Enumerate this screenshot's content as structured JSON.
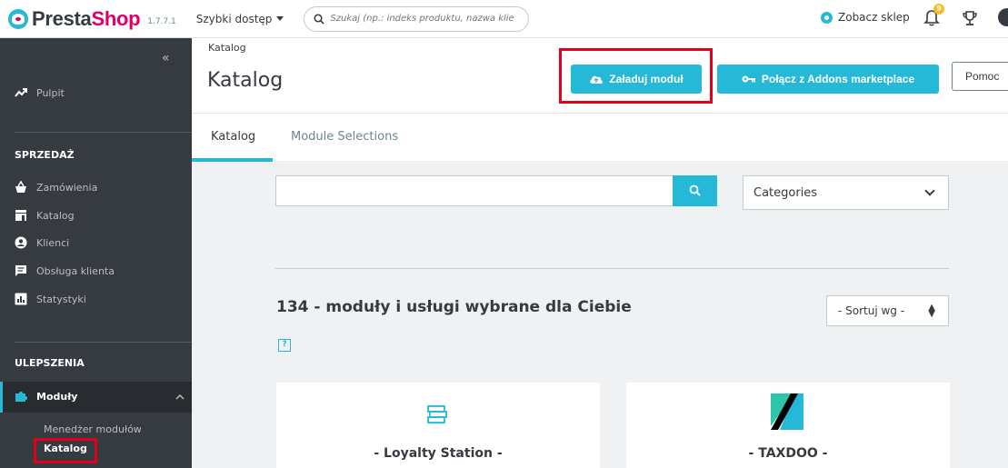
{
  "topbar": {
    "logo_part1": "Presta",
    "logo_part2": "Shop",
    "version": "1.7.7.1",
    "quick_access": "Szybki dostęp",
    "search_placeholder": "Szukaj (np.: indeks produktu, nazwa klie",
    "view_shop": "Zobacz sklep",
    "notifications_count": "9"
  },
  "sidebar": {
    "dashboard": "Pulpit",
    "sales_title": "SPRZEDAŻ",
    "sales_items": [
      "Zamówienia",
      "Katalog",
      "Klienci",
      "Obsługa klienta",
      "Statystyki"
    ],
    "improve_title": "ULEPSZENIA",
    "modules": "Moduły",
    "sub_items": [
      "Menedżer modułów",
      "Katalog"
    ]
  },
  "header": {
    "breadcrumb": "Katalog",
    "title": "Katalog",
    "upload_button": "Załaduj moduł",
    "addons_button": "Połącz z Addons marketplace",
    "help_button": "Pomoc"
  },
  "tabs": [
    "Katalog",
    "Module Selections"
  ],
  "main": {
    "search_value": "",
    "category_select": "Categories",
    "count_text": "134 - moduły i usługi wybrane dla Ciebie",
    "sort_select": "- Sortuj wg -",
    "help_icon": "?",
    "cards": [
      {
        "name": "- Loyalty Station -"
      },
      {
        "name": "- TAXDOO -"
      }
    ]
  },
  "colors": {
    "accent": "#25b9d7",
    "brand_pink": "#df0067",
    "sidebar_bg": "#363a41",
    "highlight_red": "#e4001b"
  }
}
